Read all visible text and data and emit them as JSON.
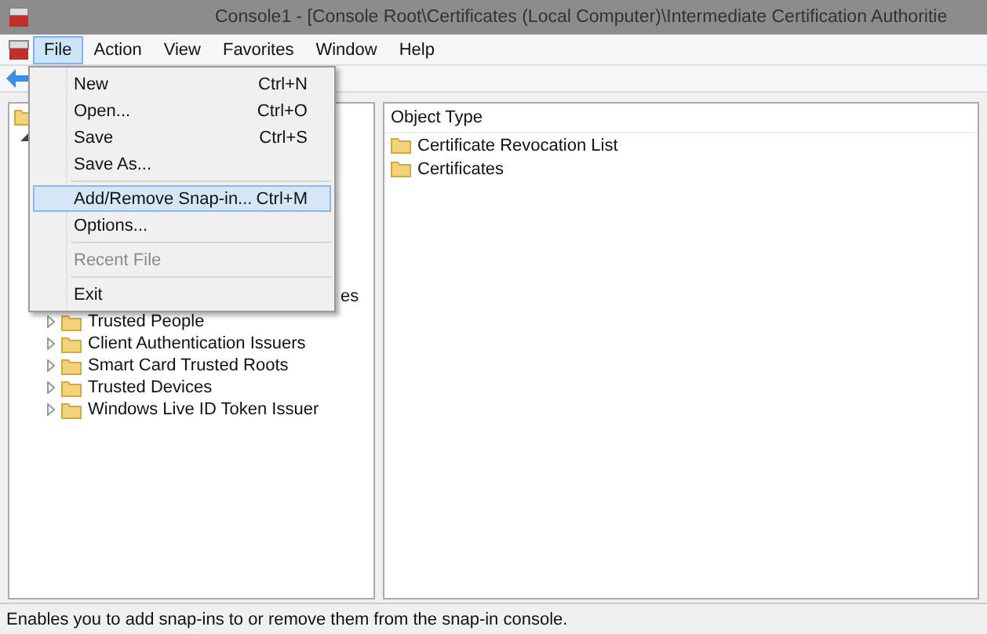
{
  "window": {
    "title": "Console1 - [Console Root\\Certificates (Local Computer)\\Intermediate Certification Authoritie"
  },
  "menu_bar": [
    {
      "label": "File",
      "selected": true
    },
    {
      "label": "Action",
      "selected": false
    },
    {
      "label": "View",
      "selected": false
    },
    {
      "label": "Favorites",
      "selected": false
    },
    {
      "label": "Window",
      "selected": false
    },
    {
      "label": "Help",
      "selected": false
    }
  ],
  "file_menu": [
    {
      "kind": "item",
      "label": "New",
      "shortcut": "Ctrl+N",
      "selected": false,
      "disabled": false
    },
    {
      "kind": "item",
      "label": "Open...",
      "shortcut": "Ctrl+O",
      "selected": false,
      "disabled": false
    },
    {
      "kind": "item",
      "label": "Save",
      "shortcut": "Ctrl+S",
      "selected": false,
      "disabled": false
    },
    {
      "kind": "item",
      "label": "Save As...",
      "selected": false,
      "disabled": false
    },
    {
      "kind": "separator"
    },
    {
      "kind": "item",
      "label": "Add/Remove Snap-in...",
      "shortcut": "Ctrl+M",
      "selected": true,
      "disabled": false
    },
    {
      "kind": "item",
      "label": "Options...",
      "selected": false,
      "disabled": false
    },
    {
      "kind": "separator"
    },
    {
      "kind": "item",
      "label": "Recent File",
      "selected": false,
      "disabled": true
    },
    {
      "kind": "separator"
    },
    {
      "kind": "item",
      "label": "Exit",
      "selected": false,
      "disabled": false
    }
  ],
  "tree": [
    {
      "label": "es",
      "partial": true
    },
    {
      "label": "Trusted People",
      "partial": false
    },
    {
      "label": "Client Authentication Issuers",
      "partial": false
    },
    {
      "label": "Smart Card Trusted Roots",
      "partial": false
    },
    {
      "label": "Trusted Devices",
      "partial": false
    },
    {
      "label": "Windows Live ID Token Issuer",
      "partial": false
    }
  ],
  "list": {
    "columns": [
      "Object Type"
    ],
    "rows": [
      "Certificate Revocation List",
      "Certificates"
    ]
  },
  "status_bar": "Enables you to add snap-ins to or remove them from the snap-in console."
}
